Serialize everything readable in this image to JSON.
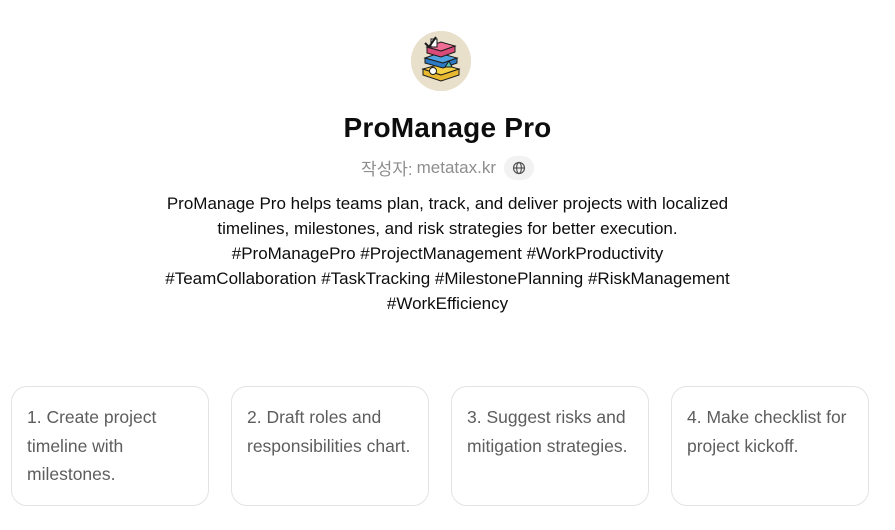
{
  "gpt": {
    "name": "ProManage Pro",
    "author_prefix": "작성자:",
    "author": "metatax.kr",
    "description": "ProManage Pro helps teams plan, track, and deliver projects with localized timelines, milestones, and risk strategies for better execution. #ProManagePro #ProjectManagement #WorkProductivity #TeamCollaboration #TaskTracking #MilestonePlanning #RiskManagement #WorkEfficiency"
  },
  "icons": {
    "avatar": "project-blocks-logo",
    "author_link": "globe-icon"
  },
  "colors": {
    "text_primary": "#0d0d0d",
    "text_secondary": "#8e8e8e",
    "card_text": "#5d5d5d",
    "card_border": "#e3e3e3"
  },
  "conversation_starters": [
    {
      "text": "1. Create project timeline with milestones."
    },
    {
      "text": "2. Draft roles and responsibilities chart."
    },
    {
      "text": "3. Suggest risks and mitigation strategies."
    },
    {
      "text": "4. Make checklist for project kickoff."
    }
  ]
}
